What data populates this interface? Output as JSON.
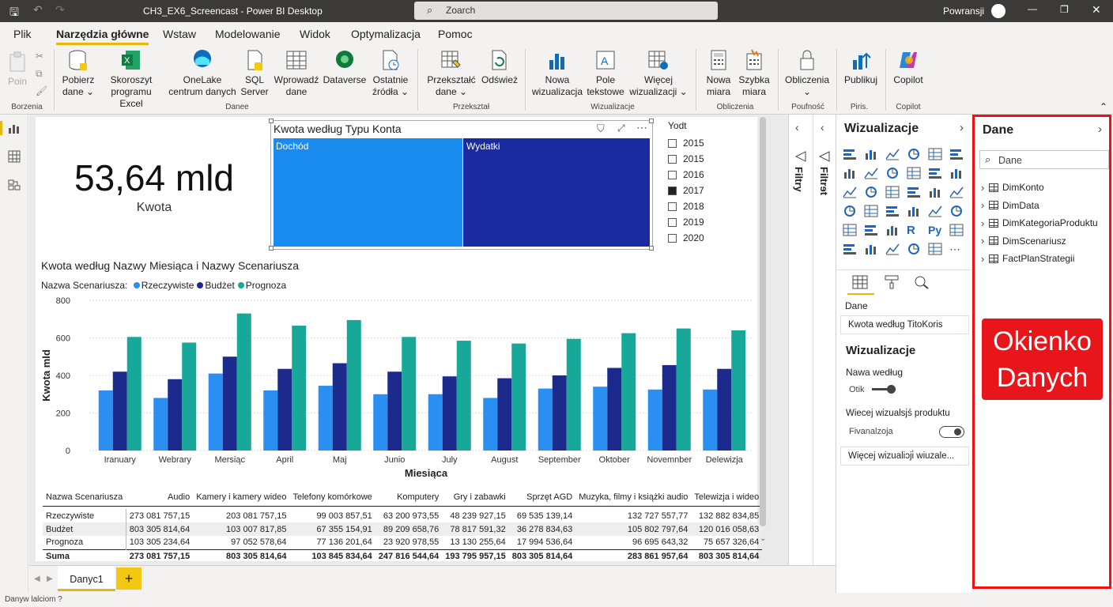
{
  "window": {
    "title": "CH3_EX6_Screencast - Power BI Desktop",
    "search": "Zoarch",
    "user": "Powransji"
  },
  "menu": [
    "Plik",
    "Narzędzia główne",
    "Wstaw",
    "Modelowanie",
    "Widok",
    "Optymalizacja",
    "Pomoc"
  ],
  "ribbon": {
    "paste": "Poin",
    "get_data": [
      "Pobierz",
      "dane ⌄"
    ],
    "excel": [
      "Skoroszyt",
      "programu Excel"
    ],
    "onelake": [
      "OneLake",
      "centrum danych"
    ],
    "sql": [
      "SQL",
      "Server"
    ],
    "enter": [
      "Wprowadź",
      "dane"
    ],
    "dataverse": "Dataverse",
    "recent": [
      "Ostatnie",
      "źródła ⌄"
    ],
    "transform": [
      "Przekształć",
      "dane ⌄"
    ],
    "refresh": "Odśwież",
    "new_visual": [
      "Nowa",
      "wizualizacja"
    ],
    "text_box": [
      "Pole",
      "tekstowe"
    ],
    "more_visuals": [
      "Więcej",
      "wizualizacji ⌄"
    ],
    "new_measure": [
      "Nowa",
      "miara"
    ],
    "quick_measure": [
      "Szybka",
      "miara"
    ],
    "calc": "Obliczenia",
    "publish": "Publikuj",
    "copilot": "Copilot",
    "groups": {
      "clipboard": "Borzenia",
      "data": "Danee",
      "transform": "Przekształ",
      "visuals": "Wizualizacje",
      "calculations": "Obliczenia",
      "sensitivity": "Poufność",
      "share": "Piris.",
      "copilot": "Copilot"
    }
  },
  "card": {
    "value": "53,64 mld",
    "label": "Kwota"
  },
  "treemap": {
    "title": "Kwota według Typu Konta",
    "items": [
      "Dochód",
      "Wydatki"
    ],
    "colors": [
      "#1a8cf0",
      "#1a2aa0"
    ]
  },
  "slicer": {
    "title": "Yodt",
    "items": [
      {
        "label": "2015",
        "checked": false
      },
      {
        "label": "2015",
        "checked": false
      },
      {
        "label": "2016",
        "checked": false
      },
      {
        "label": "2017",
        "checked": true
      },
      {
        "label": "2018",
        "checked": false
      },
      {
        "label": "2019",
        "checked": false
      },
      {
        "label": "2020",
        "checked": false
      }
    ]
  },
  "chart_data": {
    "type": "bar",
    "title": "Kwota według Nazwy Miesiąca i Nazwy Scenariusza",
    "legend_title": "Nazwa Scenariusza:",
    "xlabel": "Miesiąca",
    "ylabel": "Kwota mld",
    "ylim": [
      0,
      800
    ],
    "yticks": [
      0,
      200,
      400,
      600,
      800
    ],
    "categories": [
      "Iranuary",
      "Webrary",
      "Mersiąc",
      "April",
      "Maj",
      "Junio",
      "July",
      "August",
      "September",
      "Oktober",
      "Novemnber",
      "Delewizja"
    ],
    "series": [
      {
        "name": "Rzeczywiste",
        "color": "#2a8ff0",
        "values": [
          320,
          280,
          410,
          320,
          345,
          300,
          300,
          280,
          330,
          340,
          325,
          325
        ]
      },
      {
        "name": "Budżet",
        "color": "#1b2a8c",
        "values": [
          420,
          380,
          500,
          435,
          465,
          420,
          395,
          385,
          400,
          440,
          455,
          435
        ]
      },
      {
        "name": "Prognoza",
        "color": "#17a89a",
        "values": [
          605,
          575,
          730,
          665,
          695,
          605,
          585,
          570,
          595,
          625,
          650,
          640
        ]
      }
    ]
  },
  "matrix": {
    "headers": [
      "Nazwa Scenariusza",
      "Audio",
      "Kamery i kamery wideo",
      "Telefony komórkowe",
      "Komputery",
      "Gry i zabawki",
      "Sprzęt AGD",
      "Muzyka, filmy i książki audio",
      "Telewizja i wideo"
    ],
    "rows": [
      [
        "Rzeczywiste",
        "273 081 757,15",
        "203 081 757,15",
        "99 003 857,51",
        "63 200 973,55",
        "48 239 927,15",
        "69 535 139,14",
        "132 727 557,77",
        "132 882 834,85"
      ],
      [
        "Budżet",
        "803 305 814,64",
        "103 007 817,85",
        "67 355 154,91",
        "89 209 658,76",
        "78 817 591,32",
        "36 278 834,63",
        "105 802 797,64",
        "120 016 058,63"
      ],
      [
        "Prognoza",
        "103 305 234,64",
        "97 052 578,64",
        "77 136 201,64",
        "23 920 978,55",
        "13 130 255,64",
        "17 994 536,64",
        "96 695 643,32",
        "75 657 326,64"
      ]
    ],
    "total": [
      "Suma",
      "273 081 757,15",
      "803 305 814,64",
      "103 845 834,64",
      "247 816 544,64",
      "193 795 957,15",
      "803 305 814,64",
      "283 861 957,64",
      "803 305 814,64"
    ]
  },
  "filters": {
    "label": "Filtry",
    "label2": "Filtrɘt"
  },
  "viz_pane": {
    "title": "Wizualizacje",
    "data_label": "Dane",
    "field": "Kwota według TitoKoris",
    "section": "Wizualizacje",
    "opt1": "Nawa według",
    "toggle1": "Otik",
    "opt2": "Wiecej wizualsjś produktu",
    "toggle2": "Fivanalzoja",
    "more": "Więcej wizualiɔji̇ wiuzale..."
  },
  "data_pane": {
    "title": "Dane",
    "search_placeholder": "Dane",
    "tables": [
      "DimKonto",
      "DimData",
      "DimKategoriaProduktu",
      "DimScenariusz",
      "FactPlanStrategii"
    ]
  },
  "annotation": {
    "line1": "Okienko",
    "line2": "Danych",
    "color": "#e8161b"
  },
  "tabs": {
    "page": "Danyc1",
    "add": "+"
  },
  "status": "Danyw lalciom ?"
}
